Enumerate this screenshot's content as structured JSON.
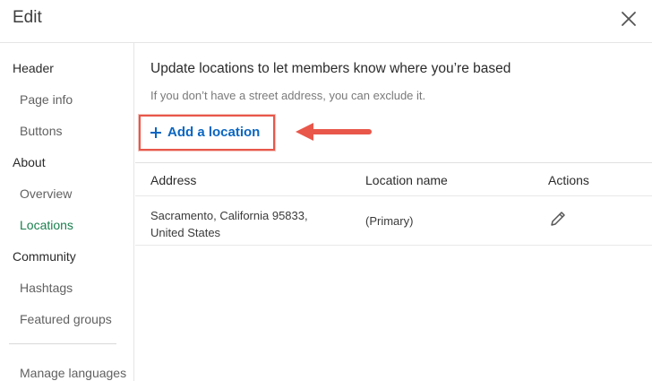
{
  "modal": {
    "title": "Edit",
    "close_icon": "close-icon"
  },
  "sidebar": {
    "items": [
      {
        "label": "Header",
        "type": "section"
      },
      {
        "label": "Page info",
        "type": "sub"
      },
      {
        "label": "Buttons",
        "type": "sub"
      },
      {
        "label": "About",
        "type": "section"
      },
      {
        "label": "Overview",
        "type": "sub"
      },
      {
        "label": "Locations",
        "type": "sub",
        "active": true
      },
      {
        "label": "Community",
        "type": "section"
      },
      {
        "label": "Hashtags",
        "type": "sub"
      },
      {
        "label": "Featured groups",
        "type": "sub"
      },
      {
        "label": "Manage languages",
        "type": "sub"
      }
    ]
  },
  "main": {
    "heading": "Update locations to let members know where you’re based",
    "subtext": "If you don’t have a street address, you can exclude it.",
    "add_button": {
      "label": "Add a location",
      "icon": "plus-icon"
    },
    "table": {
      "headers": [
        "Address",
        "Location name",
        "Actions"
      ],
      "rows": [
        {
          "address": "Sacramento, California 95833, United States",
          "location_name": "(Primary)",
          "action_icon": "pencil-icon"
        }
      ]
    }
  },
  "colors": {
    "accent_link": "#0a66c2",
    "active_nav": "#1a7f4e",
    "highlight": "#e8574a"
  }
}
